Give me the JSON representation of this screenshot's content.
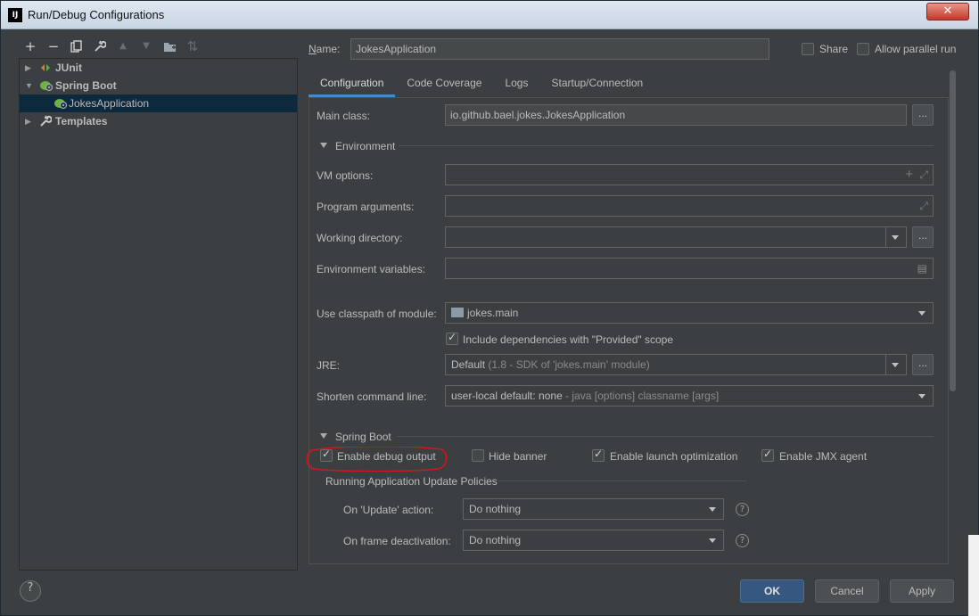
{
  "window": {
    "title": "Run/Debug Configurations",
    "app_icon": "IJ",
    "close_glyph": "✕"
  },
  "toolbar": {
    "add": "+",
    "remove": "−",
    "copy": "❐",
    "edit": "🔧",
    "up": "▲",
    "down": "▼",
    "folder": "📁",
    "sort": "⇅"
  },
  "tree": {
    "items": [
      {
        "label": "JUnit",
        "expanded": false
      },
      {
        "label": "Spring Boot",
        "expanded": true
      },
      {
        "label": "JokesApplication",
        "selected": true
      },
      {
        "label": "Templates",
        "expanded": false
      }
    ]
  },
  "header": {
    "name_label_prefix": "N",
    "name_label_rest": "ame:",
    "name_value": "JokesApplication",
    "share_label": "Share",
    "allow_parallel_label": "Allow parallel run"
  },
  "tabs": [
    "Configuration",
    "Code Coverage",
    "Logs",
    "Startup/Connection"
  ],
  "config": {
    "main_class_label": "Main class:",
    "main_class_value": "io.github.bael.jokes.JokesApplication",
    "environment_section": "Environment",
    "vm_options_label": "VM options:",
    "program_args_label": "Program arguments:",
    "working_dir_label": "Working directory:",
    "env_vars_label": "Environment variables:",
    "classpath_label": "Use classpath of module:",
    "classpath_value": "jokes.main",
    "include_deps_label": "Include dependencies with \"Provided\" scope",
    "jre_label": "JRE:",
    "jre_value": "Default",
    "jre_detail": "(1.8 - SDK of 'jokes.main' module)",
    "shorten_label": "Shorten command line:",
    "shorten_value": "user-local default: none",
    "shorten_detail": "- java [options] classname [args]",
    "ellipsis": "..."
  },
  "spring_boot": {
    "section": "Spring Boot",
    "enable_debug": "Enable debug output",
    "hide_banner": "Hide banner",
    "launch_opt": "Enable launch optimization",
    "jmx_agent": "Enable JMX agent",
    "policies_section": "Running Application Update Policies",
    "on_update_label": "On 'Update' action:",
    "on_update_value": "Do nothing",
    "on_frame_label": "On frame deactivation:",
    "on_frame_value": "Do nothing"
  },
  "buttons": {
    "help": "?",
    "ok": "OK",
    "cancel": "Cancel",
    "apply": "Apply"
  },
  "colors": {
    "annotation": "#d01818",
    "selection": "#0d293e",
    "tab_accent": "#4a88c7"
  }
}
